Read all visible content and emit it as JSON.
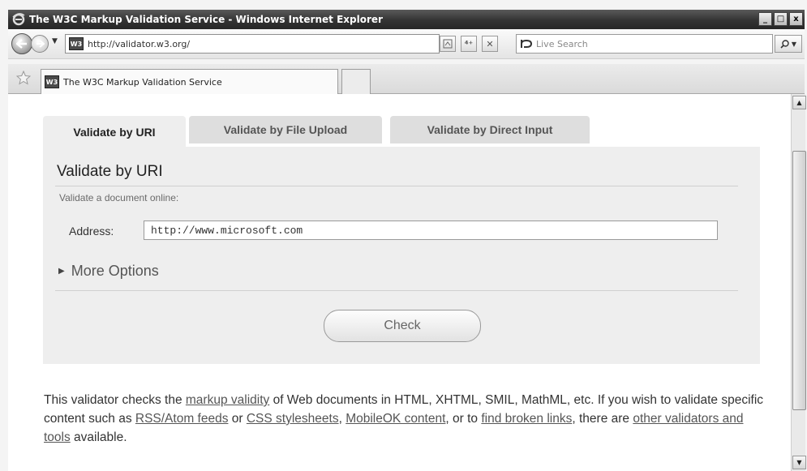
{
  "window": {
    "title": "The W3C Markup Validation Service - Windows Internet Explorer",
    "controls": [
      "_",
      "□",
      "x"
    ]
  },
  "navbar": {
    "address": "http://validator.w3.org/",
    "favicon_text": "W3",
    "search_placeholder": "Live Search"
  },
  "tabs": [
    {
      "label": "The W3C Markup Validation Service"
    }
  ],
  "validator": {
    "tabs": [
      {
        "label": "Validate by URI",
        "active": true
      },
      {
        "label": "Validate by File Upload",
        "active": false
      },
      {
        "label": "Validate by Direct Input",
        "active": false
      }
    ],
    "panel_title": "Validate by URI",
    "subtitle": "Validate a document online:",
    "address_label": "Address:",
    "address_value": "http://www.microsoft.com",
    "more_options": "More Options",
    "check_label": "Check"
  },
  "description": {
    "p1": "This validator checks the ",
    "link1": "markup validity",
    "p2": " of Web documents in HTML, XHTML, SMIL, MathML, etc. If you wish to validate specific content such as ",
    "link2": "RSS/Atom feeds",
    "p3": " or ",
    "link3": "CSS stylesheets",
    "p4": ", ",
    "link4": "MobileOK content",
    "p5": ", or to ",
    "link5": "find broken links",
    "p6": ", there are ",
    "link6": "other validators and tools",
    "p7": " available."
  }
}
